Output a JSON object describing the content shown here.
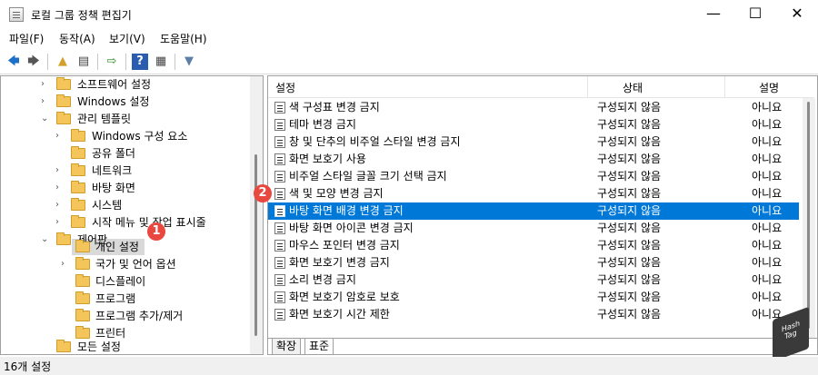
{
  "window": {
    "title": "로컬 그룹 정책 편집기",
    "minimize": "—",
    "maximize": "☐",
    "close": "✕"
  },
  "menu": [
    "파일(F)",
    "동작(A)",
    "보기(V)",
    "도움말(H)"
  ],
  "toolbar": {
    "back": "🡄",
    "forward": "🡆",
    "up": "▲",
    "show_hide": "▤",
    "export": "⇨",
    "help": "?",
    "properties": "▦",
    "filter": "▼"
  },
  "tree": [
    {
      "label": "소프트웨어 설정",
      "chevron": "›"
    },
    {
      "label": "Windows 설정",
      "chevron": "›"
    },
    {
      "label": "관리 템플릿",
      "chevron": "⌄"
    },
    {
      "label": "Windows 구성 요소",
      "chevron": "›"
    },
    {
      "label": "공유 폴더",
      "chevron": ""
    },
    {
      "label": "네트워크",
      "chevron": "›"
    },
    {
      "label": "바탕 화면",
      "chevron": "›"
    },
    {
      "label": "시스템",
      "chevron": "›"
    },
    {
      "label": "시작 메뉴 및 작업 표시줄",
      "chevron": "›"
    },
    {
      "label": "제어판",
      "chevron": "⌄"
    },
    {
      "label": "개인 설정",
      "chevron": ""
    },
    {
      "label": "국가 및 언어 옵션",
      "chevron": "›"
    },
    {
      "label": "디스플레이",
      "chevron": ""
    },
    {
      "label": "프로그램",
      "chevron": ""
    },
    {
      "label": "프로그램 추가/제거",
      "chevron": ""
    },
    {
      "label": "프린터",
      "chevron": ""
    },
    {
      "label": "모든 설정",
      "chevron": ""
    }
  ],
  "columns": {
    "name": "설정",
    "state": "상태",
    "desc": "설명"
  },
  "rows": [
    {
      "name": "색 구성표 변경 금지",
      "state": "구성되지 않음",
      "desc": "아니요"
    },
    {
      "name": "테마 변경 금지",
      "state": "구성되지 않음",
      "desc": "아니요"
    },
    {
      "name": "창 및 단추의 비주얼 스타일 변경 금지",
      "state": "구성되지 않음",
      "desc": "아니요"
    },
    {
      "name": "화면 보호기 사용",
      "state": "구성되지 않음",
      "desc": "아니요"
    },
    {
      "name": "비주얼 스타일 글꼴 크기 선택 금지",
      "state": "구성되지 않음",
      "desc": "아니요"
    },
    {
      "name": "색 및 모양 변경 금지",
      "state": "구성되지 않음",
      "desc": "아니요"
    },
    {
      "name": "바탕 화면 배경 변경 금지",
      "state": "구성되지 않음",
      "desc": "아니요"
    },
    {
      "name": "바탕 화면 아이콘 변경 금지",
      "state": "구성되지 않음",
      "desc": "아니요"
    },
    {
      "name": "마우스 포인터 변경 금지",
      "state": "구성되지 않음",
      "desc": "아니요"
    },
    {
      "name": "화면 보호기 변경 금지",
      "state": "구성되지 않음",
      "desc": "아니요"
    },
    {
      "name": "소리 변경 금지",
      "state": "구성되지 않음",
      "desc": "아니요"
    },
    {
      "name": "화면 보호기 암호로 보호",
      "state": "구성되지 않음",
      "desc": "아니요"
    },
    {
      "name": "화면 보호기 시간 제한",
      "state": "구성되지 않음",
      "desc": "아니요"
    }
  ],
  "tabs": [
    "확장",
    "표준"
  ],
  "status": "16개 설정",
  "annotations": [
    "1",
    "2"
  ],
  "watermark": [
    "Hash",
    "Tag"
  ],
  "colors": {
    "selection": "#0078d7",
    "badge": "#e8483f"
  }
}
